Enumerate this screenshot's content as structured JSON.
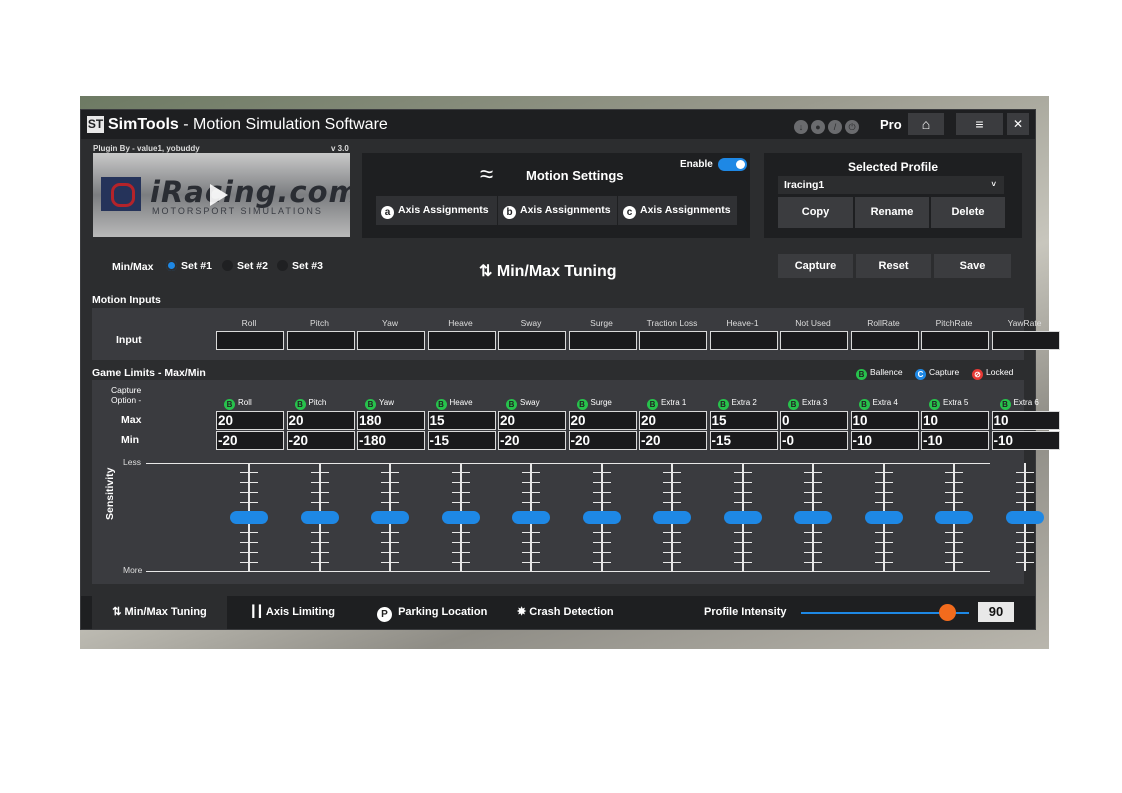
{
  "app": {
    "title_prefix": "SimTools",
    "title_suffix": " - Motion Simulation Software",
    "logo_glyph": "ST",
    "pro_label": "Pro",
    "home_icon": "⌂",
    "menu_icon": "≡",
    "close_icon": "✕"
  },
  "plugin": {
    "credits": "Plugin By - value1, yobuddy",
    "version": "v 3.0",
    "banner_brand": "iRacing.com",
    "banner_sub": "MOTORSPORT SIMULATIONS"
  },
  "motion_settings": {
    "title": "Motion Settings",
    "enable_label": "Enable",
    "enabled": true,
    "axis_buttons": [
      {
        "icon": "a",
        "label": "Axis Assignments"
      },
      {
        "icon": "b",
        "label": "Axis Assignments"
      },
      {
        "icon": "c",
        "label": "Axis Assignments"
      }
    ]
  },
  "profile": {
    "title": "Selected Profile",
    "selected": "Iracing1",
    "chevron": "˅",
    "buttons": [
      "Copy",
      "Rename",
      "Delete"
    ]
  },
  "tuning": {
    "minmax_label": "Min/Max",
    "sets": [
      "Set #1",
      "Set #2",
      "Set #3"
    ],
    "selected_set": 0,
    "title": "Min/Max Tuning",
    "title_icon": "⇅",
    "actions": [
      "Capture",
      "Reset",
      "Save"
    ]
  },
  "motion_inputs": {
    "section_label": "Motion Inputs",
    "row_label": "Input",
    "columns": [
      "Roll",
      "Pitch",
      "Yaw",
      "Heave",
      "Sway",
      "Surge",
      "Traction Loss",
      "Heave-1",
      "Not Used",
      "RollRate",
      "PitchRate",
      "YawRate"
    ]
  },
  "game_limits": {
    "section_label": "Game Limits - Max/Min",
    "legend": [
      {
        "glyph": "B",
        "label": "Ballence",
        "color": "#27c24c"
      },
      {
        "glyph": "C",
        "label": "Capture",
        "color": "#1e88e5"
      },
      {
        "glyph": "⊘",
        "label": "Locked",
        "color": "#e53935"
      }
    ],
    "capture_option_label": "Capture Option -",
    "capture_badge": "B",
    "columns": [
      "Roll",
      "Pitch",
      "Yaw",
      "Heave",
      "Sway",
      "Surge",
      "Extra 1",
      "Extra 2",
      "Extra 3",
      "Extra 4",
      "Extra 5",
      "Extra 6"
    ],
    "max_label": "Max",
    "min_label": "Min",
    "max": [
      "20",
      "20",
      "180",
      "15",
      "20",
      "20",
      "20",
      "15",
      "0",
      "10",
      "10",
      "10"
    ],
    "min": [
      "-20",
      "-20",
      "-180",
      "-15",
      "-20",
      "-20",
      "-20",
      "-15",
      "-0",
      "-10",
      "-10",
      "-10"
    ]
  },
  "sensitivity": {
    "label": "Sensitivity",
    "less": "Less",
    "more": "More",
    "levels": [
      0.5,
      0.5,
      0.5,
      0.5,
      0.5,
      0.5,
      0.5,
      0.5,
      0.5,
      0.5,
      0.5,
      0.5
    ]
  },
  "bottom": {
    "tabs": [
      {
        "icon": "⇅",
        "label": "Min/Max Tuning",
        "active": true
      },
      {
        "icon": "┃┃",
        "label": "Axis Limiting",
        "active": false
      },
      {
        "icon": "P",
        "label": "Parking Location",
        "active": false
      },
      {
        "icon": "✸",
        "label": "Crash Detection",
        "active": false
      }
    ],
    "intensity_label": "Profile Intensity",
    "intensity_value": "90",
    "intensity_fraction": 0.9
  },
  "colors": {
    "accent": "#1e88e5",
    "slider_knob": "#f26b1d",
    "window_bg": "#2c2d2f"
  }
}
